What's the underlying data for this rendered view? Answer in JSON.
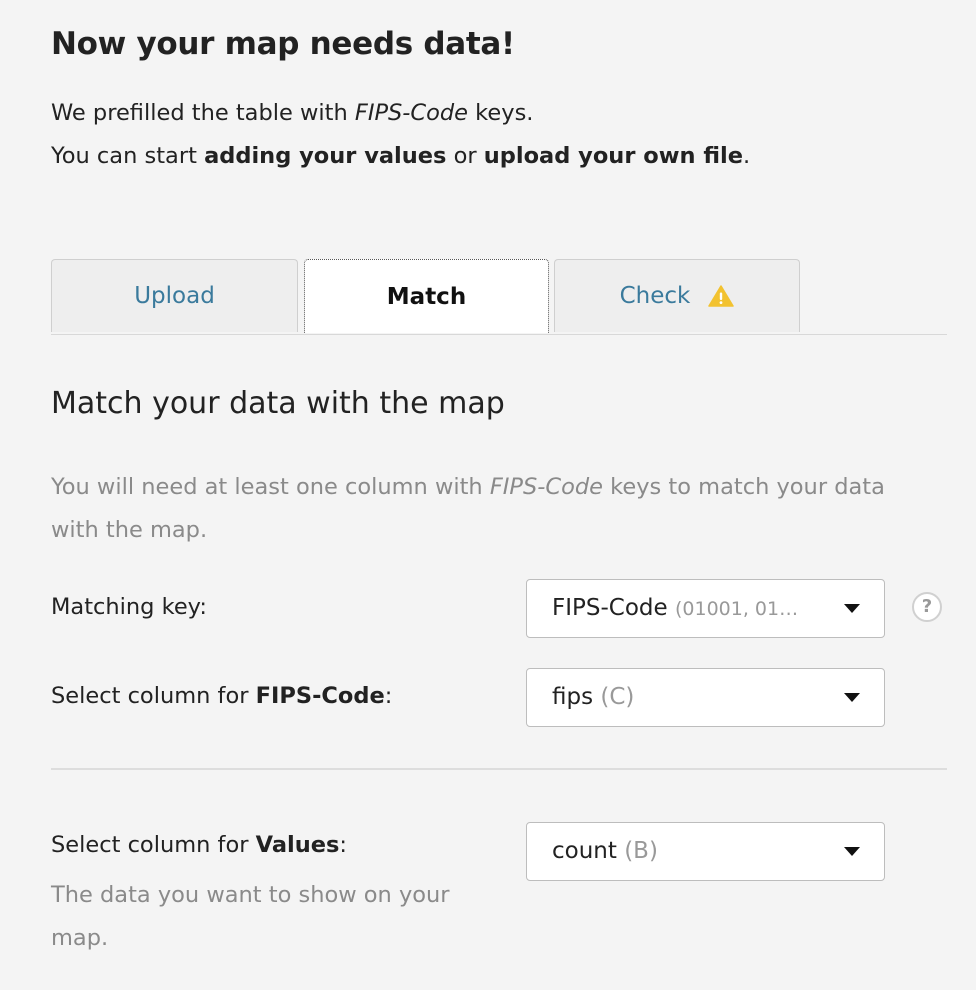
{
  "header": {
    "title": "Now your map needs data!",
    "intro_line1_before": "We prefilled the table with ",
    "intro_line1_key": "FIPS-Code",
    "intro_line1_after": " keys.",
    "intro_line2_before": "You can start ",
    "intro_line2_bold1": "adding your values",
    "intro_line2_mid": " or ",
    "intro_line2_bold2": "upload your own file",
    "intro_line2_after": "."
  },
  "tabs": [
    {
      "label": "Upload",
      "active": false
    },
    {
      "label": "Match",
      "active": true
    },
    {
      "label": "Check",
      "active": false,
      "icon": "warning-icon"
    }
  ],
  "colors": {
    "tab_link": "#3a7a9c",
    "warning": "#f2c230",
    "muted_text": "#8a8a8a",
    "background": "#f4f4f4"
  },
  "match": {
    "title": "Match your data with the map",
    "help_before": "You will need at least one column with ",
    "help_key": "FIPS-Code",
    "help_after": " keys to match your data with the map.",
    "matching_key": {
      "label": "Matching key:",
      "value": "FIPS-Code",
      "hint": "(01001, 01…",
      "help_icon_text": "?"
    },
    "key_column": {
      "label_before": "Select column for ",
      "label_bold": "FIPS-Code",
      "label_after": ":",
      "value": "fips",
      "hint": "(C)"
    },
    "value_column": {
      "label_before": "Select column for ",
      "label_bold": "Values",
      "label_after": ":",
      "value": "count",
      "hint": "(B)",
      "description": "The data you want to show on your map."
    }
  }
}
